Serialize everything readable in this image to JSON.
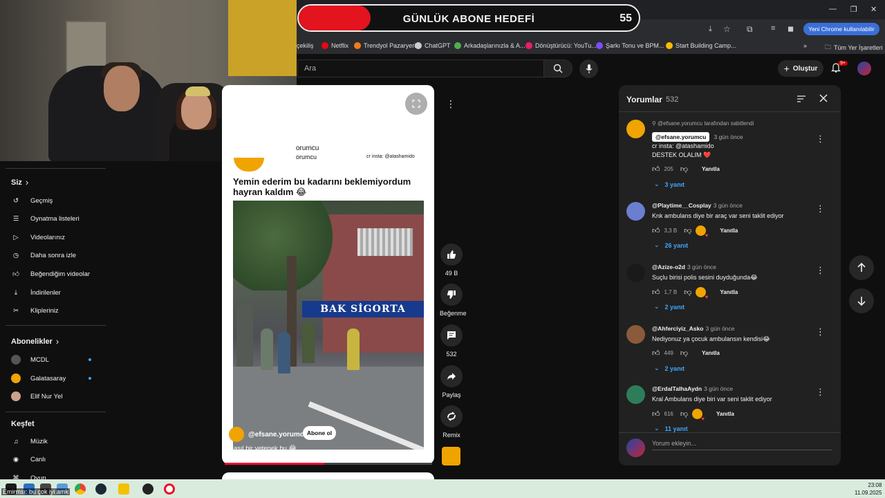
{
  "browser": {
    "new_chrome_pill": "Yeni Chrome kullanılabilir",
    "bookmarks": [
      {
        "label": "çekiliş",
        "color": "#888888"
      },
      {
        "label": "Netflix",
        "color": "#e50914"
      },
      {
        "label": "Trendyol Pazaryeri",
        "color": "#f27a1a"
      },
      {
        "label": "ChatGPT",
        "color": "#cccccc"
      },
      {
        "label": "Arkadaşlarınızla & A...",
        "color": "#4caf50"
      },
      {
        "label": "Dönüştürücü: YouTu...",
        "color": "#e91e63"
      },
      {
        "label": "Şarkı Tonu ve BPM...",
        "color": "#7c4dff"
      },
      {
        "label": "Start Building Camp...",
        "color": "#fbbc04"
      }
    ],
    "all_bookmarks": "Tüm Yer İşaretleri",
    "more_bookmarks": "»"
  },
  "goal_banner": {
    "title": "GÜNLÜK ABONE HEDEFİ",
    "count": "55"
  },
  "youtube": {
    "search_placeholder": "Ara",
    "create_label": "Oluştur",
    "notif_badge": "9+"
  },
  "sidebar": {
    "you_header": "Siz",
    "you_items": [
      {
        "label": "Geçmiş",
        "icon": "history-icon"
      },
      {
        "label": "Oynatma listeleri",
        "icon": "playlist-icon"
      },
      {
        "label": "Videolarınız",
        "icon": "video-icon"
      },
      {
        "label": "Daha sonra izle",
        "icon": "clock-icon"
      },
      {
        "label": "Beğendiğim videolar",
        "icon": "thumbs-up-icon"
      },
      {
        "label": "İndirilenler",
        "icon": "download-icon"
      },
      {
        "label": "Klipleriniz",
        "icon": "scissors-icon"
      }
    ],
    "subs_header": "Abonelikler",
    "subs": [
      {
        "label": "MCDL",
        "color": "#555555",
        "new": true
      },
      {
        "label": "Galatasaray",
        "color": "#f0a400",
        "new": true
      },
      {
        "label": "Elif Nur Yel",
        "color": "#caa28a",
        "new": false
      }
    ],
    "explore_header": "Keşfet",
    "explore_items": [
      {
        "label": "Müzik",
        "icon": "music-icon"
      },
      {
        "label": "Canlı",
        "icon": "live-icon"
      },
      {
        "label": "Oyun",
        "icon": "gamepad-icon"
      }
    ]
  },
  "short": {
    "top_user_line1": "orumcu",
    "top_user_line2": "orumcu",
    "cr_text": "cr insta: @atashamido",
    "caption": "Yemin ederim bu kadarını beklemiyordum hayran kaldım 😂",
    "sign_text": "BAK SİGORTA",
    "channel": "@efsane.yorumcu",
    "subscribe": "Abone ol",
    "description": "Nasıl bir yetenek bu 😂",
    "progress": 0.48,
    "likes": "49 B",
    "dislike_label": "Beğenme",
    "comments_count": "532",
    "share_label": "Paylaş",
    "remix_label": "Remix"
  },
  "comments": {
    "title": "Yorumlar",
    "count": "532",
    "pinned_by": "@efsane.yorumcu tarafından sabitlendi",
    "items": [
      {
        "author": "@efsane.yorumcu",
        "time": "3 gün önce",
        "lines": [
          "cr insta: @atashamido",
          "DESTEK OLALIM ❤️"
        ],
        "likes": "205",
        "reply": "Yanıtla",
        "replies": "3 yanıt",
        "creator_heart": false,
        "avatar": "#f0a400"
      },
      {
        "author": "@Playtime__Cosplay",
        "time": "3 gün önce",
        "lines": [
          "Knk ambulans diye bir araç var seni taklit ediyor"
        ],
        "likes": "3,3 B",
        "reply": "Yanıtla",
        "replies": "26 yanıt",
        "creator_heart": true,
        "avatar": "#6b7ed0"
      },
      {
        "author": "@Azize-o2d",
        "time": "3 gün önce",
        "lines": [
          "Suçlu birisi polis sesini duyduğunda😂"
        ],
        "likes": "1,7 B",
        "reply": "Yanıtla",
        "replies": "2 yanıt",
        "creator_heart": true,
        "avatar": "#1a1a1a"
      },
      {
        "author": "@Ahferciyiz_Asko",
        "time": "3 gün önce",
        "lines": [
          "Nediyonuz ya çocuk ambulansın kendisi😂"
        ],
        "likes": "449",
        "reply": "Yanıtla",
        "replies": "2 yanıt",
        "creator_heart": false,
        "avatar": "#8a5a3a"
      },
      {
        "author": "@ErdalTalhaAydn",
        "time": "3 gün önce",
        "lines": [
          "Kral Ambulans diye biri var seni taklit ediyor"
        ],
        "likes": "616",
        "reply": "Yanıtla",
        "replies": "11 yanıt",
        "creator_heart": true,
        "avatar": "#2e7d5a"
      }
    ],
    "add_placeholder": "Yorum ekleyin..."
  },
  "taskbar": {
    "ticker": "Emirmsı: bu çok iyi amk",
    "time": "23:08",
    "date": "11.09.2025"
  }
}
